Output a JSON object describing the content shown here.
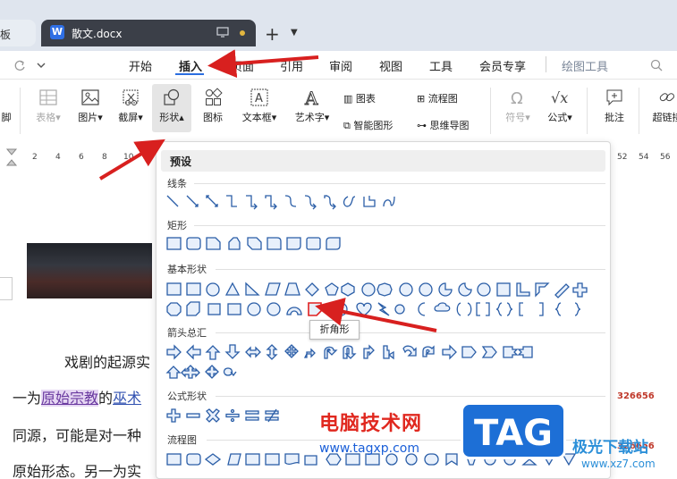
{
  "titlebar": {
    "prev_tab": "板",
    "doc_tab": "散文.docx",
    "new_tab": "+"
  },
  "menu": [
    "开始",
    "插入",
    "页面",
    "引用",
    "审阅",
    "视图",
    "工具",
    "会员专享",
    "绘图工具"
  ],
  "ribbon": {
    "table": "表格",
    "picture": "图片",
    "screenshot": "截屏",
    "shape": "形状",
    "icon": "图标",
    "textbox": "文本框",
    "wordart": "艺术字",
    "chart": "图表",
    "smartart": "智能图形",
    "flowchart": "流程图",
    "mindmap": "思维导图",
    "symbol": "符号",
    "formula": "公式",
    "comment": "批注",
    "hyperlink": "超链接",
    "left_cut": "脚"
  },
  "ruler": [
    "2",
    "4",
    "6",
    "8",
    "10",
    "52",
    "54",
    "56"
  ],
  "document": {
    "line1": "戏剧的起源实",
    "line2_a": "一为",
    "line2_hl": "原始宗教",
    "line2_b": "的",
    "line2_link": "巫术",
    "line3": "同源，可能是对一种",
    "line4": "原始形态。另一为实",
    "side1": "326656",
    "side2": "326656"
  },
  "panel": {
    "preset": "预设",
    "sections": [
      "线条",
      "矩形",
      "基本形状",
      "箭头总汇",
      "公式形状",
      "流程图"
    ],
    "tooltip": "折角形"
  },
  "watermark": {
    "text": "电脑技术网",
    "url": "www.tagxp.com",
    "tag": "TAG",
    "site2": "极光下载站",
    "site2_url": "www.xz7.com"
  }
}
